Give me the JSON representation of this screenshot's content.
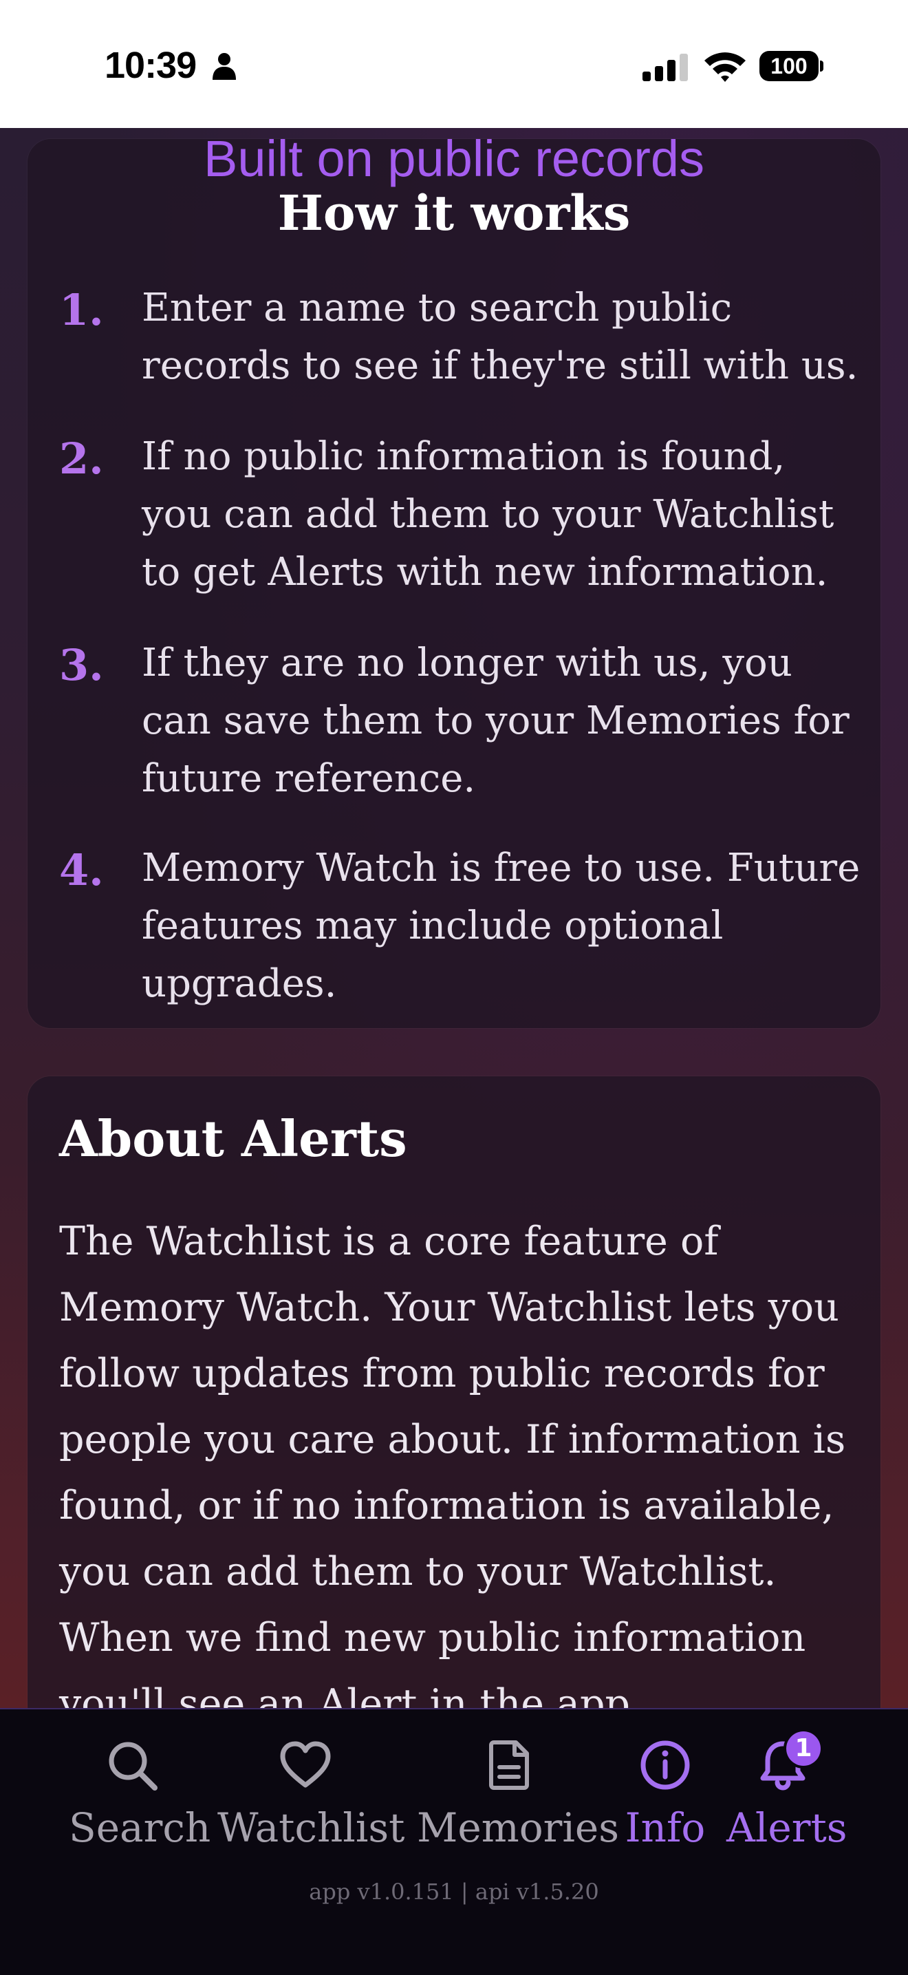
{
  "status_bar": {
    "time": "10:39",
    "battery": "100"
  },
  "banner": {
    "text": "Built on public records"
  },
  "how_it_works": {
    "title": "How it works",
    "steps": [
      {
        "num": "1.",
        "text": "Enter a name to search public records to see if they're still with us."
      },
      {
        "num": "2.",
        "text": "If no public information is found, you can add them to your Watchlist to get Alerts with new information."
      },
      {
        "num": "3.",
        "text": "If they are no longer with us, you can save them to your Memories for future reference."
      },
      {
        "num": "4.",
        "text": "Memory Watch is free to use. Future features may include optional upgrades."
      }
    ]
  },
  "about_alerts": {
    "title": "About Alerts",
    "body": "The Watchlist is a core feature of Memory Watch. Your Watchlist lets you follow updates from public records for people you care about. If information is found, or if no information is available, you can add them to your Watchlist. When we find new public information you'll see an Alert in the app."
  },
  "tab_bar": {
    "tabs": [
      {
        "label": "Search",
        "icon": "search-icon"
      },
      {
        "label": "Watchlist",
        "icon": "heart-icon"
      },
      {
        "label": "Memories",
        "icon": "document-icon"
      },
      {
        "label": "Info",
        "icon": "info-icon"
      },
      {
        "label": "Alerts",
        "icon": "bell-icon",
        "badge": "1"
      }
    ],
    "active": "Info"
  },
  "version": "app v1.0.151 | api v1.5.20",
  "colors": {
    "accent": "#a46ff0",
    "badge": "#9b57ef",
    "step_number": "#b574ec"
  }
}
